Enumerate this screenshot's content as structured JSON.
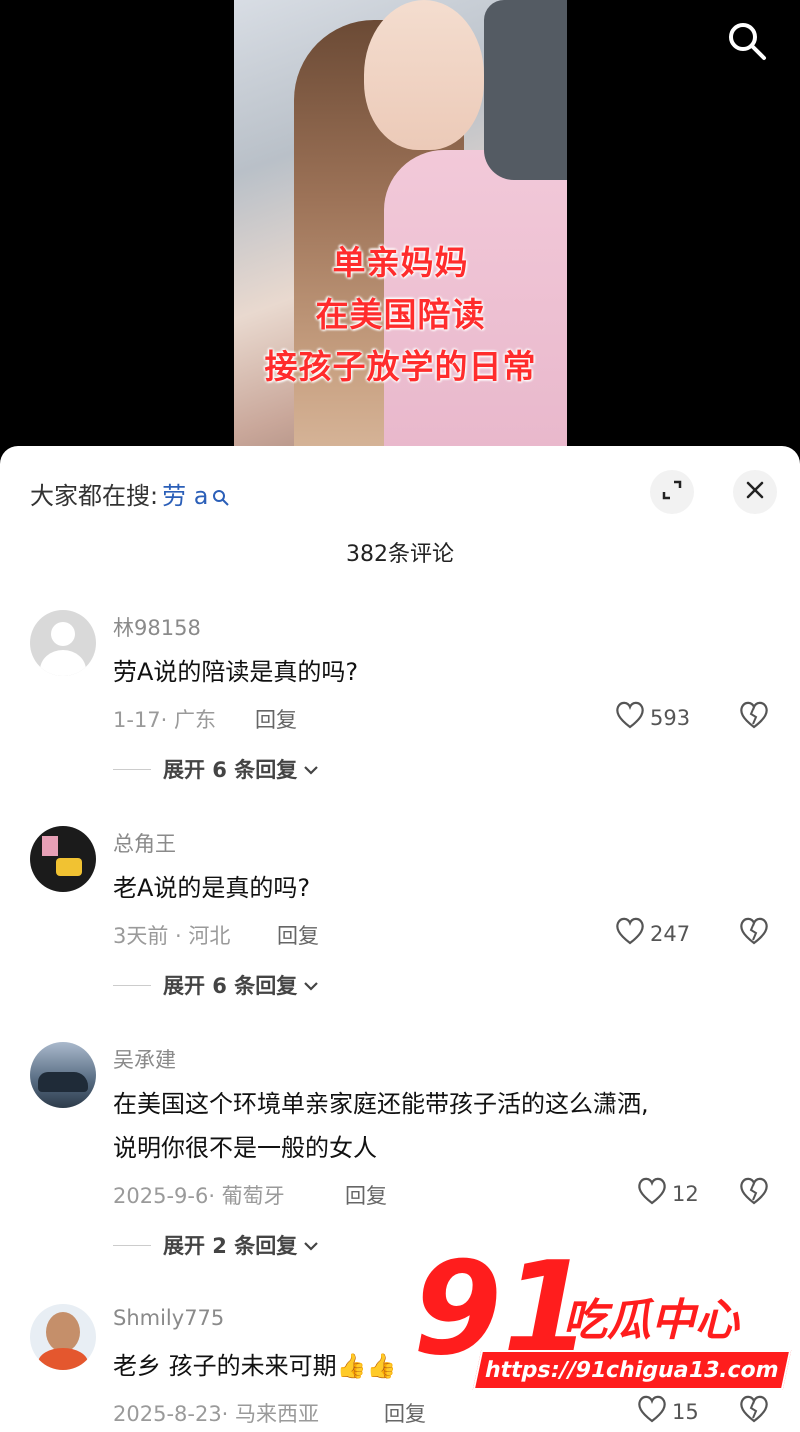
{
  "video": {
    "caption_lines": [
      "单亲妈妈",
      "在美国陪读",
      "接孩子放学的日常"
    ],
    "top_icon": "search-icon"
  },
  "sheet": {
    "hot_search_prefix": "大家都在搜:",
    "hot_search_keyword": "劳 a",
    "expand_icon": "expand-icon",
    "close_icon": "close-icon",
    "comment_count_title": "382条评论"
  },
  "comments": [
    {
      "username": "林98158",
      "text": "劳A说的陪读是真的吗?",
      "meta": "1-17· 广东",
      "reply_label": "回复",
      "likes": "593",
      "expand_label": "展开 6 条回复"
    },
    {
      "username": "总角王",
      "text": "老A说的是真的吗?",
      "meta": "3天前 · 河北",
      "reply_label": "回复",
      "likes": "247",
      "expand_label": "展开 6 条回复"
    },
    {
      "username": "吴承建",
      "text_line1": "在美国这个环境单亲家庭还能带孩子活的这么潇洒,",
      "text_line2": "说明你很不是一般的女人",
      "meta": "2025-9-6· 葡萄牙",
      "reply_label": "回复",
      "likes": "12",
      "expand_label": "展开 2 条回复"
    },
    {
      "username": "Shmily775",
      "text": "老乡 孩子的未来可期👍👍",
      "meta": "2025-8-23· 马来西亚",
      "reply_label": "回复",
      "likes": "15"
    }
  ],
  "watermark": {
    "number": "91",
    "name": "吃瓜中心",
    "url": "https://91chigua13.com"
  },
  "colors": {
    "caption_red": "#ff2c2c",
    "keyword_blue": "#2b5fb8",
    "watermark_red": "#ff1d1d"
  }
}
